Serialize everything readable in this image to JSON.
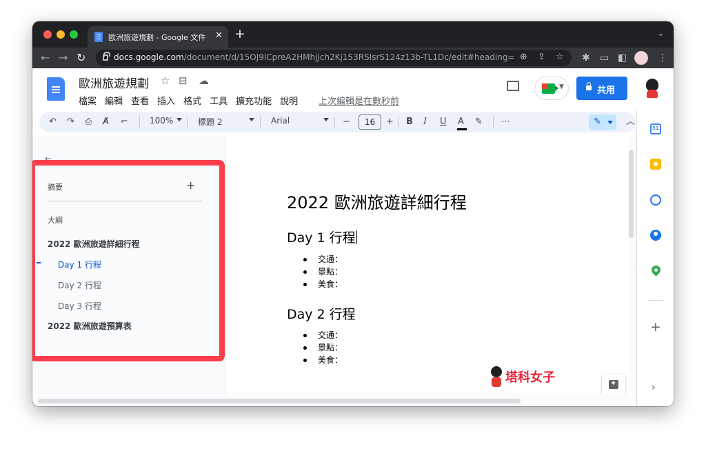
{
  "browser": {
    "tab_title": "歐洲旅遊規劃 - Google 文件",
    "tab_close": "✕",
    "new_tab": "+",
    "url_host": "docs.google.com",
    "url_path": "/document/d/15OJ9lCpreA2HMhjjch2Kj153RSIsrS124z13b-TL1Dc/edit#heading=h.8j..."
  },
  "docs": {
    "title": "歐洲旅遊規劃",
    "menu": [
      "檔案",
      "編輯",
      "查看",
      "插入",
      "格式",
      "工具",
      "擴充功能",
      "說明"
    ],
    "last_edit": "上次編輯是在數秒前",
    "share_label": "共用"
  },
  "toolbar": {
    "zoom": "100%",
    "style": "標題 2",
    "font": "Arial",
    "font_size": "16",
    "minus": "−",
    "plus": "+",
    "bold": "B",
    "italic": "I",
    "underline": "U",
    "text_color": "A",
    "more": "⋯"
  },
  "outline": {
    "summary_label": "摘要",
    "summary_add": "+",
    "outline_label": "大綱",
    "items": [
      {
        "text": "2022 歐洲旅遊詳細行程",
        "level": 1
      },
      {
        "text": "Day 1 行程",
        "level": 2,
        "active": true
      },
      {
        "text": "Day 2 行程",
        "level": 2
      },
      {
        "text": "Day 3 行程",
        "level": 2
      },
      {
        "text": "2022 歐洲旅遊預算表",
        "level": 1
      }
    ]
  },
  "document": {
    "heading": "2022 歐洲旅遊詳細行程",
    "day1_title": "Day 1 行程",
    "day2_title": "Day 2 行程",
    "bullets": [
      "交通：",
      "景點：",
      "美食："
    ]
  },
  "watermark": "塔科女子",
  "colors": {
    "highlight": "#fc3d4c",
    "accent_blue": "#1a73e8",
    "active_outline": "#0b57d0"
  }
}
